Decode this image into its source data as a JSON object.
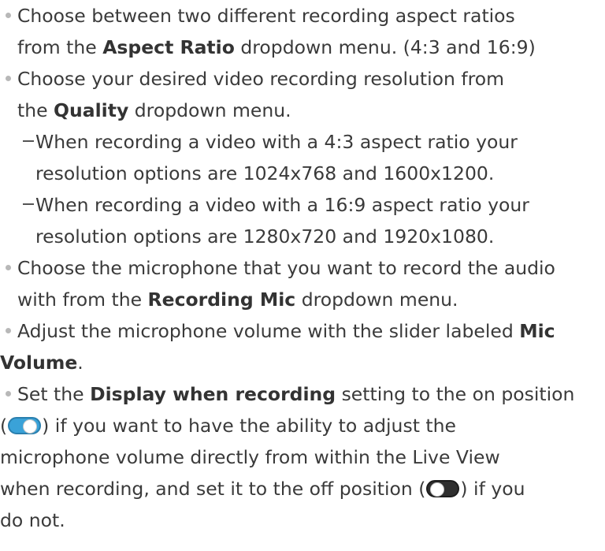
{
  "bullets": {
    "b1": {
      "l1": "Choose between two different recording aspect ratios",
      "l2_pre": "from the ",
      "l2_bold": "Aspect Ratio",
      "l2_post": " dropdown menu. (4:3 and 16:9)"
    },
    "b2": {
      "l1": "Choose your desired video recording resolution from",
      "l2_pre": "the ",
      "l2_bold": "Quality",
      "l2_post": " dropdown menu."
    },
    "sub1": {
      "l1": "When recording a video with a 4:3 aspect ratio your",
      "l2": "resolution options are 1024x768 and 1600x1200."
    },
    "sub2": {
      "l1": "When recording a video with a 16:9 aspect ratio your",
      "l2": "resolution options are 1280x720 and 1920x1080."
    },
    "b3": {
      "l1": "Choose the microphone that you want to record the audio",
      "l2_pre": "with from the ",
      "l2_bold": "Recording Mic",
      "l2_post": " dropdown menu."
    },
    "b4": {
      "l1_pre": "Adjust the microphone volume with the slider labeled ",
      "l1_bold": "Mic",
      "l2_bold": "Volume",
      "l2_post": "."
    },
    "b5": {
      "l1_pre": "Set the ",
      "l1_bold": "Display when recording",
      "l1_post": " setting to the on position",
      "l2_pre": "(",
      "l2_post": ") if you want to have the ability to adjust the",
      "l3": "microphone volume directly from within the Live View",
      "l4_pre": "when recording, and set it to the off position (",
      "l4_post": ") if you",
      "l5": "do not."
    }
  },
  "toggles": {
    "on_icon": "toggle-on-icon",
    "off_icon": "toggle-off-icon",
    "on_color": "#3aa2d8",
    "off_color": "#2f2f2f"
  }
}
